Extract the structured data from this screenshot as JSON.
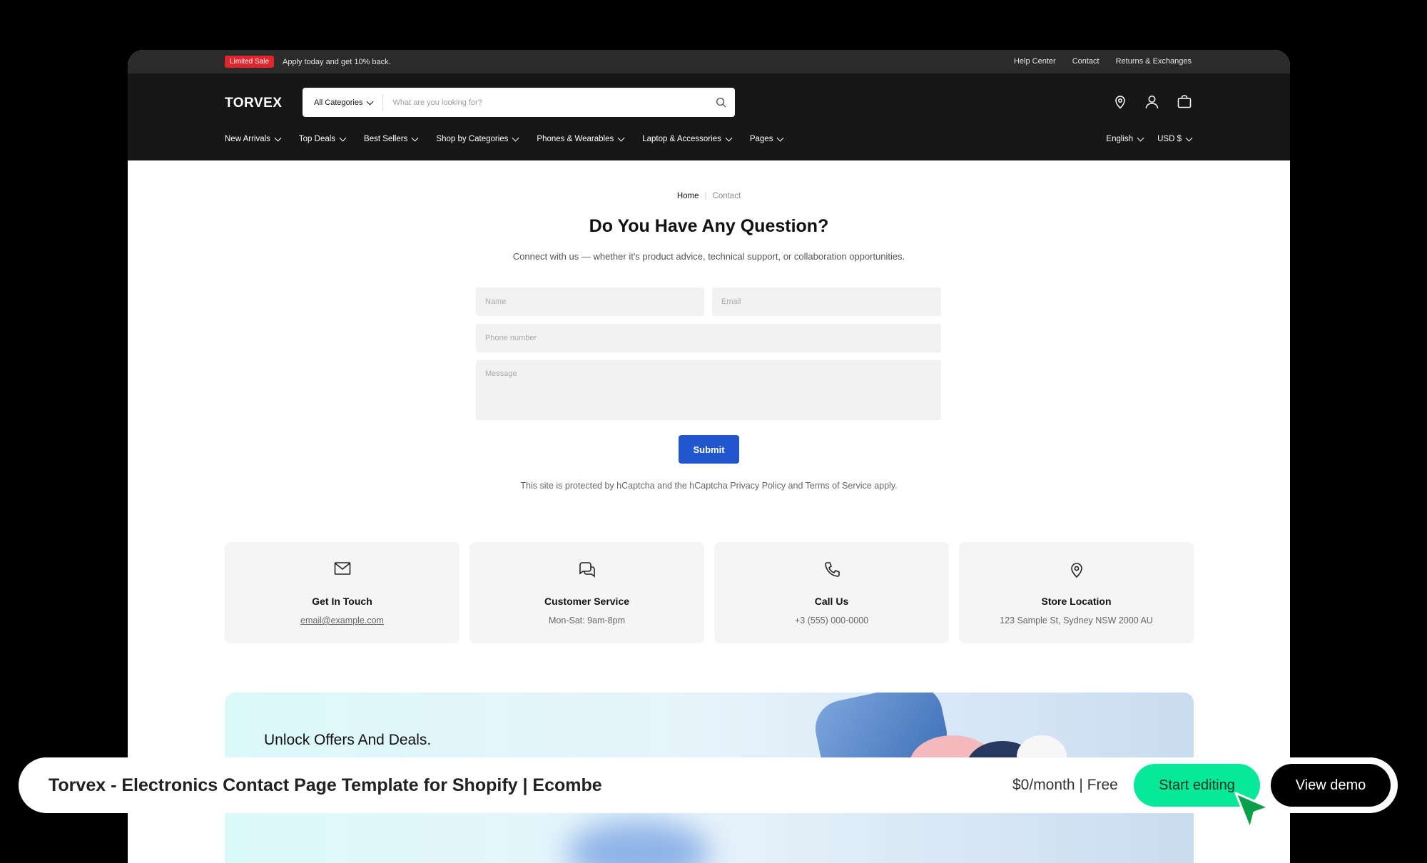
{
  "announcement": {
    "badge": "Limited Sale",
    "text": "Apply today and get 10% back.",
    "links": [
      "Help Center",
      "Contact",
      "Returns & Exchanges"
    ]
  },
  "header": {
    "logo": "TORVEX",
    "search": {
      "category": "All Categories",
      "placeholder": "What are you looking for?",
      "value": ""
    },
    "icons": [
      "location-pin-icon",
      "user-icon",
      "bag-icon"
    ]
  },
  "nav": {
    "items": [
      "New Arrivals",
      "Top Deals",
      "Best Sellers",
      "Shop by Categories",
      "Phones & Wearables",
      "Laptop & Accessories",
      "Pages"
    ],
    "language": "English",
    "currency": "USD $"
  },
  "breadcrumb": {
    "home": "Home",
    "current": "Contact"
  },
  "contact": {
    "title": "Do You Have Any Question?",
    "subtitle": "Connect with us — whether it's product advice, technical support, or collaboration opportunities.",
    "form": {
      "name_placeholder": "Name",
      "email_placeholder": "Email",
      "phone_placeholder": "Phone number",
      "message_placeholder": "Message",
      "submit_label": "Submit"
    },
    "captcha_note": "This site is protected by hCaptcha and the hCaptcha Privacy Policy and Terms of Service apply.",
    "accent_color": "#2156cf"
  },
  "cards": [
    {
      "icon": "mail-icon",
      "title": "Get In Touch",
      "value": "email@example.com"
    },
    {
      "icon": "chat-icon",
      "title": "Customer Service",
      "value": "Mon-Sat: 9am-8pm"
    },
    {
      "icon": "phone-icon",
      "title": "Call Us",
      "value": "+3 (555) 000-0000"
    },
    {
      "icon": "location-pin-icon",
      "title": "Store Location",
      "value": "123 Sample St, Sydney NSW 2000 AU"
    }
  ],
  "banner": {
    "title": "Unlock Offers And Deals."
  },
  "bottom_bar": {
    "title": "Torvex - Electronics Contact Page Template for Shopify | Ecombe",
    "price": "$0/month | Free",
    "start_label": "Start editing",
    "demo_label": "View demo",
    "start_color": "#07e89b"
  }
}
